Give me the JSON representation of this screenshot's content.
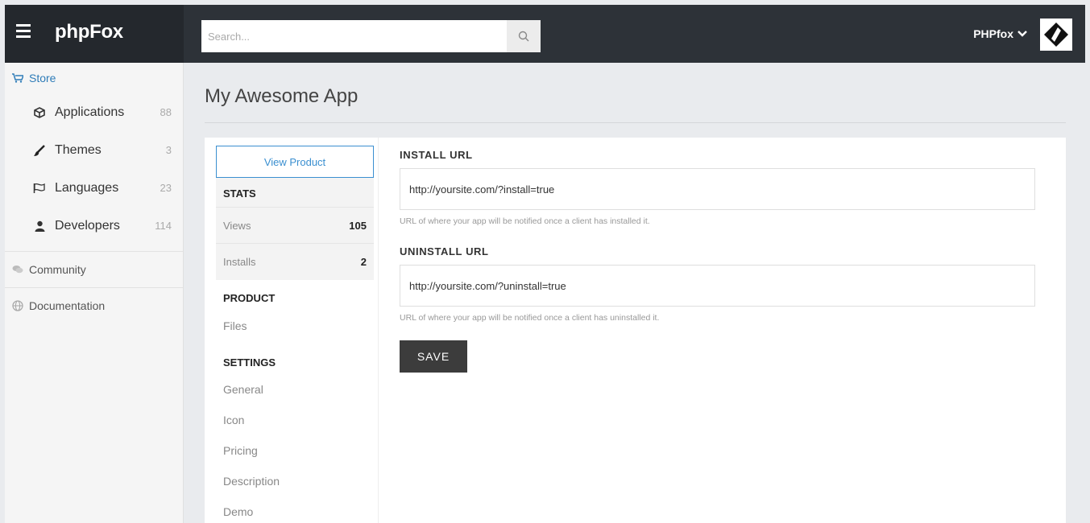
{
  "header": {
    "brand": "phpFox",
    "search_placeholder": "Search...",
    "user_name": "PHPfox"
  },
  "sidebar": {
    "store_label": "Store",
    "items": [
      {
        "label": "Applications",
        "count": "88"
      },
      {
        "label": "Themes",
        "count": "3"
      },
      {
        "label": "Languages",
        "count": "23"
      },
      {
        "label": "Developers",
        "count": "114"
      }
    ],
    "community_label": "Community",
    "documentation_label": "Documentation"
  },
  "main": {
    "title": "My Awesome App",
    "view_product_label": "View Product",
    "stats": {
      "heading": "STATS",
      "rows": [
        {
          "label": "Views",
          "value": "105"
        },
        {
          "label": "Installs",
          "value": "2"
        }
      ]
    },
    "product": {
      "heading": "PRODUCT",
      "links": [
        "Files"
      ]
    },
    "settings": {
      "heading": "SETTINGS",
      "links": [
        "General",
        "Icon",
        "Pricing",
        "Description",
        "Demo"
      ]
    },
    "form": {
      "install_label": "INSTALL URL",
      "install_value": "http://yoursite.com/?install=true",
      "install_help": "URL of where your app will be notified once a client has installed it.",
      "uninstall_label": "UNINSTALL URL",
      "uninstall_value": "http://yoursite.com/?uninstall=true",
      "uninstall_help": "URL of where your app will be notified once a client has uninstalled it.",
      "save_label": "SAVE"
    }
  },
  "colors": {
    "topbar": "#2d3238",
    "accent": "#3a8fd0",
    "store_link": "#2e7cb8",
    "save_button": "#3c3c3c"
  },
  "icons": {
    "menu": "hamburger-icon",
    "search": "search-icon",
    "user_dropdown": "chevron-down-icon",
    "store": "cart-icon",
    "applications": "cube-icon",
    "themes": "brush-icon",
    "languages": "flag-icon",
    "developers": "user-icon",
    "community": "chat-icon",
    "documentation": "globe-icon"
  }
}
